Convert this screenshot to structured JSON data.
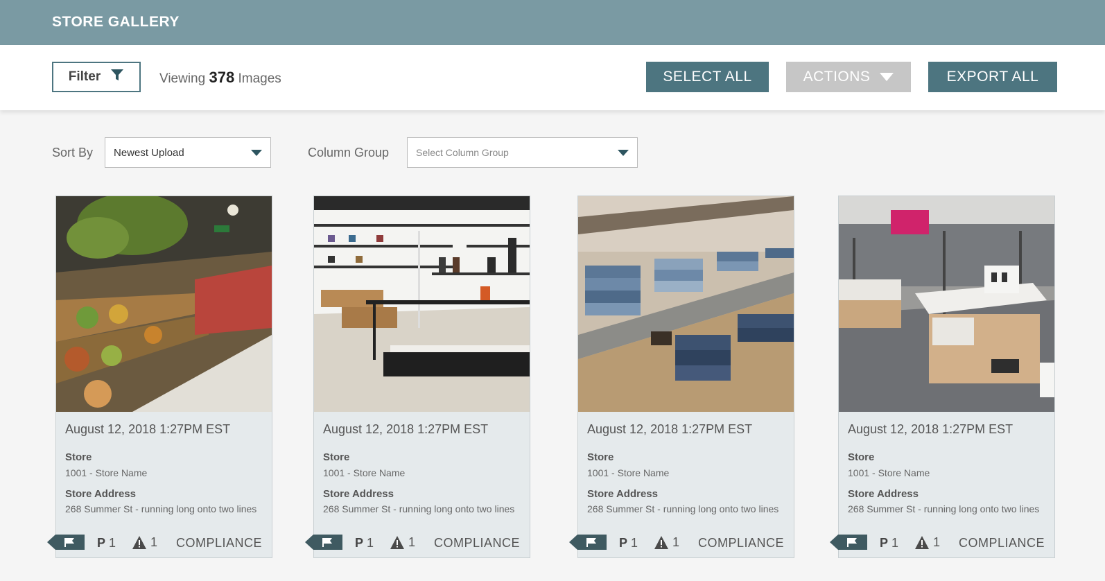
{
  "header": {
    "title": "STORE GALLERY"
  },
  "toolbar": {
    "filter_label": "Filter",
    "viewing_prefix": "Viewing",
    "viewing_count": "378",
    "viewing_suffix": "Images",
    "select_all": "SELECT ALL",
    "actions": "ACTIONS",
    "export_all": "EXPORT ALL"
  },
  "sort": {
    "sort_by_label": "Sort By",
    "sort_by_value": "Newest Upload",
    "column_group_label": "Column Group",
    "column_group_placeholder": "Select Column Group"
  },
  "colors": {
    "header": "#7a9aa3",
    "primary_button": "#4d7580",
    "disabled_button": "#c6c6c6",
    "card_bg": "#e5eaec",
    "flag_tag": "#3f5a61"
  },
  "cards": [
    {
      "photo_icon": "grocery-store-photo",
      "date": "August 12, 2018 1:27PM EST",
      "store_label": "Store",
      "store_value": "1001 - Store Name",
      "address_label": "Store Address",
      "address_value": "268 Summer St - running long onto two lines",
      "priority_letter": "P",
      "priority_count": "1",
      "warning_count": "1",
      "compliance": "COMPLIANCE"
    },
    {
      "photo_icon": "shoe-store-photo",
      "date": "August 12, 2018 1:27PM EST",
      "store_label": "Store",
      "store_value": "1001 - Store Name",
      "address_label": "Store Address",
      "address_value": "268 Summer St - running long onto two lines",
      "priority_letter": "P",
      "priority_count": "1",
      "warning_count": "1",
      "compliance": "COMPLIANCE"
    },
    {
      "photo_icon": "denim-shelf-photo",
      "date": "August 12, 2018 1:27PM EST",
      "store_label": "Store",
      "store_value": "1001 - Store Name",
      "address_label": "Store Address",
      "address_value": "268 Summer St - running long onto two lines",
      "priority_letter": "P",
      "priority_count": "1",
      "warning_count": "1",
      "compliance": "COMPLIANCE"
    },
    {
      "photo_icon": "electronics-store-photo",
      "date": "August 12, 2018 1:27PM EST",
      "store_label": "Store",
      "store_value": "1001 - Store Name",
      "address_label": "Store Address",
      "address_value": "268 Summer St - running long onto two lines",
      "priority_letter": "P",
      "priority_count": "1",
      "warning_count": "1",
      "compliance": "COMPLIANCE"
    }
  ]
}
